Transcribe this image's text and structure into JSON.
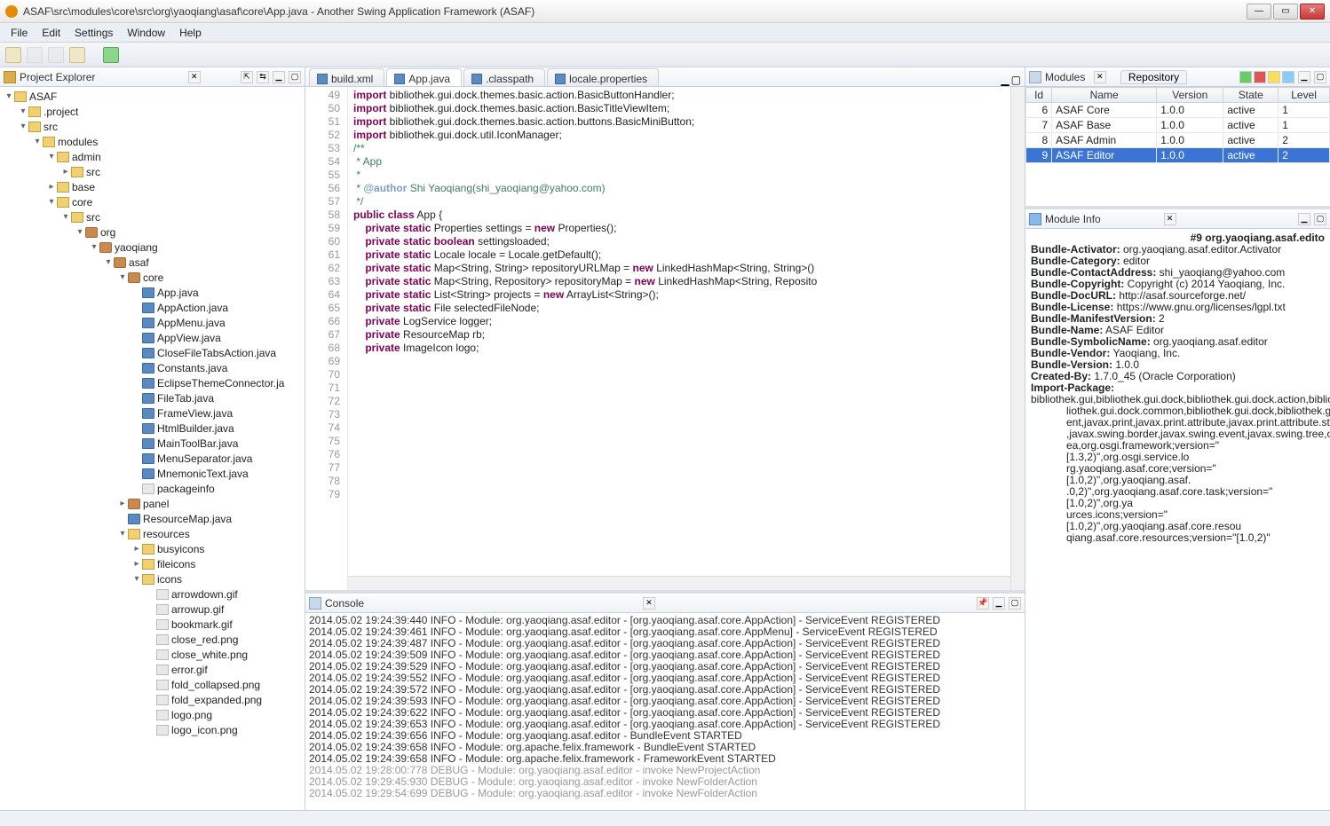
{
  "window": {
    "title": "ASAF\\src\\modules\\core\\src\\org\\yaoqiang\\asaf\\core\\App.java - Another Swing Application Framework (ASAF)"
  },
  "menu": [
    "File",
    "Edit",
    "Settings",
    "Window",
    "Help"
  ],
  "views": {
    "projectExplorer": "Project Explorer",
    "modules": "Modules",
    "repository": "Repository",
    "moduleInfo": "Module Info",
    "console": "Console"
  },
  "tree": {
    "root": "ASAF",
    "nodes": [
      {
        "depth": 1,
        "tw": "▾",
        "icon": "folder",
        "label": ".project"
      },
      {
        "depth": 1,
        "tw": "▾",
        "icon": "folder",
        "label": "src"
      },
      {
        "depth": 2,
        "tw": "▾",
        "icon": "folder",
        "label": "modules"
      },
      {
        "depth": 3,
        "tw": "▾",
        "icon": "folder",
        "label": "admin"
      },
      {
        "depth": 4,
        "tw": "▸",
        "icon": "folder",
        "label": "src"
      },
      {
        "depth": 3,
        "tw": "▸",
        "icon": "folder",
        "label": "base"
      },
      {
        "depth": 3,
        "tw": "▾",
        "icon": "folder",
        "label": "core"
      },
      {
        "depth": 4,
        "tw": "▾",
        "icon": "folder",
        "label": "src"
      },
      {
        "depth": 5,
        "tw": "▾",
        "icon": "pkg",
        "label": "org"
      },
      {
        "depth": 6,
        "tw": "▾",
        "icon": "pkg",
        "label": "yaoqiang"
      },
      {
        "depth": 7,
        "tw": "▾",
        "icon": "pkg",
        "label": "asaf"
      },
      {
        "depth": 8,
        "tw": "▾",
        "icon": "pkg",
        "label": "core"
      },
      {
        "depth": 9,
        "tw": "",
        "icon": "java",
        "label": "App.java"
      },
      {
        "depth": 9,
        "tw": "",
        "icon": "java",
        "label": "AppAction.java"
      },
      {
        "depth": 9,
        "tw": "",
        "icon": "java",
        "label": "AppMenu.java"
      },
      {
        "depth": 9,
        "tw": "",
        "icon": "java",
        "label": "AppView.java"
      },
      {
        "depth": 9,
        "tw": "",
        "icon": "java",
        "label": "CloseFileTabsAction.java"
      },
      {
        "depth": 9,
        "tw": "",
        "icon": "java",
        "label": "Constants.java"
      },
      {
        "depth": 9,
        "tw": "",
        "icon": "java",
        "label": "EclipseThemeConnector.ja"
      },
      {
        "depth": 9,
        "tw": "",
        "icon": "java",
        "label": "FileTab.java"
      },
      {
        "depth": 9,
        "tw": "",
        "icon": "java",
        "label": "FrameView.java"
      },
      {
        "depth": 9,
        "tw": "",
        "icon": "java",
        "label": "HtmlBuilder.java"
      },
      {
        "depth": 9,
        "tw": "",
        "icon": "java",
        "label": "MainToolBar.java"
      },
      {
        "depth": 9,
        "tw": "",
        "icon": "java",
        "label": "MenuSeparator.java"
      },
      {
        "depth": 9,
        "tw": "",
        "icon": "java",
        "label": "MnemonicText.java"
      },
      {
        "depth": 9,
        "tw": "",
        "icon": "file",
        "label": "packageinfo"
      },
      {
        "depth": 8,
        "tw": "▸",
        "icon": "pkg",
        "label": "panel"
      },
      {
        "depth": 8,
        "tw": "",
        "icon": "java",
        "label": "ResourceMap.java"
      },
      {
        "depth": 8,
        "tw": "▾",
        "icon": "folder",
        "label": "resources"
      },
      {
        "depth": 9,
        "tw": "▸",
        "icon": "folder",
        "label": "busyicons"
      },
      {
        "depth": 9,
        "tw": "▸",
        "icon": "folder",
        "label": "fileicons"
      },
      {
        "depth": 9,
        "tw": "▾",
        "icon": "folder",
        "label": "icons"
      },
      {
        "depth": 10,
        "tw": "",
        "icon": "file",
        "label": "arrowdown.gif"
      },
      {
        "depth": 10,
        "tw": "",
        "icon": "file",
        "label": "arrowup.gif"
      },
      {
        "depth": 10,
        "tw": "",
        "icon": "file",
        "label": "bookmark.gif"
      },
      {
        "depth": 10,
        "tw": "",
        "icon": "file",
        "label": "close_red.png"
      },
      {
        "depth": 10,
        "tw": "",
        "icon": "file",
        "label": "close_white.png"
      },
      {
        "depth": 10,
        "tw": "",
        "icon": "file",
        "label": "error.gif"
      },
      {
        "depth": 10,
        "tw": "",
        "icon": "file",
        "label": "fold_collapsed.png"
      },
      {
        "depth": 10,
        "tw": "",
        "icon": "file",
        "label": "fold_expanded.png"
      },
      {
        "depth": 10,
        "tw": "",
        "icon": "file",
        "label": "logo.png"
      },
      {
        "depth": 10,
        "tw": "",
        "icon": "file",
        "label": "logo_icon.png"
      }
    ]
  },
  "tabs": [
    {
      "label": "build.xml",
      "active": false
    },
    {
      "label": "App.java",
      "active": true
    },
    {
      "label": ".classpath",
      "active": false
    },
    {
      "label": "locale.properties",
      "active": false
    }
  ],
  "editor": {
    "firstLine": 49,
    "lines": [
      "import bibliothek.gui.dock.themes.basic.action.BasicButtonHandler;",
      "import bibliothek.gui.dock.themes.basic.action.BasicTitleViewItem;",
      "import bibliothek.gui.dock.themes.basic.action.buttons.BasicMiniButton;",
      "import bibliothek.gui.dock.util.IconManager;",
      "",
      "/**",
      " * App",
      " *",
      " * @author Shi Yaoqiang(shi_yaoqiang@yahoo.com)",
      " */",
      "public class App {",
      "",
      "    private static Properties settings = new Properties();",
      "",
      "    private static boolean settingsloaded;",
      "",
      "    private static Locale locale = Locale.getDefault();",
      "",
      "    private static Map<String, String> repositoryURLMap = new LinkedHashMap<String, String>()",
      "",
      "    private static Map<String, Repository> repositoryMap = new LinkedHashMap<String, Reposito",
      "",
      "    private static List<String> projects = new ArrayList<String>();",
      "",
      "    private static File selectedFileNode;",
      "",
      "    private LogService logger;",
      "",
      "    private ResourceMap rb;",
      "",
      "    private ImageIcon logo;"
    ]
  },
  "modules": {
    "headers": [
      "Id",
      "Name",
      "Version",
      "State",
      "Level"
    ],
    "rows": [
      {
        "id": "6",
        "name": "ASAF Core",
        "version": "1.0.0",
        "state": "active",
        "level": "1"
      },
      {
        "id": "7",
        "name": "ASAF Base",
        "version": "1.0.0",
        "state": "active",
        "level": "1"
      },
      {
        "id": "8",
        "name": "ASAF Admin",
        "version": "1.0.0",
        "state": "active",
        "level": "2"
      },
      {
        "id": "9",
        "name": "ASAF Editor",
        "version": "1.0.0",
        "state": "active",
        "level": "2",
        "selected": true
      }
    ]
  },
  "moduleInfo": {
    "headline": "#9 org.yaoqiang.asaf.edito",
    "fields": [
      {
        "k": "Bundle-Activator:",
        "v": " org.yaoqiang.asaf.editor.Activator"
      },
      {
        "k": "Bundle-Category:",
        "v": " editor"
      },
      {
        "k": "Bundle-ContactAddress:",
        "v": " shi_yaoqiang@yahoo.com"
      },
      {
        "k": "Bundle-Copyright:",
        "v": " Copyright (c) 2014 Yaoqiang, Inc."
      },
      {
        "k": "Bundle-DocURL:",
        "v": " http://asaf.sourceforge.net/"
      },
      {
        "k": "Bundle-License:",
        "v": " https://www.gnu.org/licenses/lgpl.txt"
      },
      {
        "k": "Bundle-ManifestVersion:",
        "v": " 2"
      },
      {
        "k": "Bundle-Name:",
        "v": " ASAF Editor"
      },
      {
        "k": "Bundle-SymbolicName:",
        "v": " org.yaoqiang.asaf.editor"
      },
      {
        "k": "Bundle-Vendor:",
        "v": " Yaoqiang, Inc."
      },
      {
        "k": "Bundle-Version:",
        "v": " 1.0.0"
      },
      {
        "k": "Created-By:",
        "v": " 1.7.0_45 (Oracle Corporation)"
      },
      {
        "k": "Import-Package:",
        "v": " bibliothek.gui,bibliothek.gui.dock,bibliothek.gui.dock.action,bibliothek."
      }
    ],
    "cont": [
      "liothek.gui.dock.common,bibliothek.gui.dock,bibliothek.gui.dock.common.intern,l",
      "ent,javax.print,javax.print.attribute,javax.print.attribute.st",
      ",javax.swing.border,javax.swing.event,javax.swing.tree,or",
      "ea,org.osgi.framework;version=\"[1.3,2)\",org.osgi.service.lo",
      "rg.yaoqiang.asaf.core;version=\"[1.0,2)\",org.yaoqiang.asaf.",
      ".0,2)\",org.yaoqiang.asaf.core.task;version=\"[1.0,2)\",org.ya",
      "urces.icons;version=\"[1.0,2)\",org.yaoqiang.asaf.core.resou",
      "qiang.asaf.core.resources;version=\"[1.0,2)\""
    ]
  },
  "console": [
    {
      "t": "2014.05.02 19:24:39:440 INFO - Module: org.yaoqiang.asaf.editor - [org.yaoqiang.asaf.core.AppAction] - ServiceEvent REGISTERED"
    },
    {
      "t": "2014.05.02 19:24:39:461 INFO - Module: org.yaoqiang.asaf.editor - [org.yaoqiang.asaf.core.AppMenu] - ServiceEvent REGISTERED"
    },
    {
      "t": "2014.05.02 19:24:39:487 INFO - Module: org.yaoqiang.asaf.editor - [org.yaoqiang.asaf.core.AppAction] - ServiceEvent REGISTERED"
    },
    {
      "t": "2014.05.02 19:24:39:509 INFO - Module: org.yaoqiang.asaf.editor - [org.yaoqiang.asaf.core.AppAction] - ServiceEvent REGISTERED"
    },
    {
      "t": "2014.05.02 19:24:39:529 INFO - Module: org.yaoqiang.asaf.editor - [org.yaoqiang.asaf.core.AppAction] - ServiceEvent REGISTERED"
    },
    {
      "t": "2014.05.02 19:24:39:552 INFO - Module: org.yaoqiang.asaf.editor - [org.yaoqiang.asaf.core.AppAction] - ServiceEvent REGISTERED"
    },
    {
      "t": "2014.05.02 19:24:39:572 INFO - Module: org.yaoqiang.asaf.editor - [org.yaoqiang.asaf.core.AppAction] - ServiceEvent REGISTERED"
    },
    {
      "t": "2014.05.02 19:24:39:593 INFO - Module: org.yaoqiang.asaf.editor - [org.yaoqiang.asaf.core.AppAction] - ServiceEvent REGISTERED"
    },
    {
      "t": "2014.05.02 19:24:39:622 INFO - Module: org.yaoqiang.asaf.editor - [org.yaoqiang.asaf.core.AppAction] - ServiceEvent REGISTERED"
    },
    {
      "t": "2014.05.02 19:24:39:653 INFO - Module: org.yaoqiang.asaf.editor - [org.yaoqiang.asaf.core.AppAction] - ServiceEvent REGISTERED"
    },
    {
      "t": "2014.05.02 19:24:39:656 INFO - Module: org.yaoqiang.asaf.editor - BundleEvent STARTED"
    },
    {
      "t": "2014.05.02 19:24:39:658 INFO - Module: org.apache.felix.framework - BundleEvent STARTED"
    },
    {
      "t": "2014.05.02 19:24:39:658 INFO - Module: org.apache.felix.framework - FrameworkEvent STARTED"
    },
    {
      "t": "2014.05.02 19:28:00:778 DEBUG - Module: org.yaoqiang.asaf.editor - invoke NewProjectAction",
      "d": true
    },
    {
      "t": "2014.05.02 19:29:45:930 DEBUG - Module: org.yaoqiang.asaf.editor - invoke NewFolderAction",
      "d": true
    },
    {
      "t": "2014.05.02 19:29:54:699 DEBUG - Module: org.yaoqiang.asaf.editor - invoke NewFolderAction",
      "d": true
    }
  ]
}
